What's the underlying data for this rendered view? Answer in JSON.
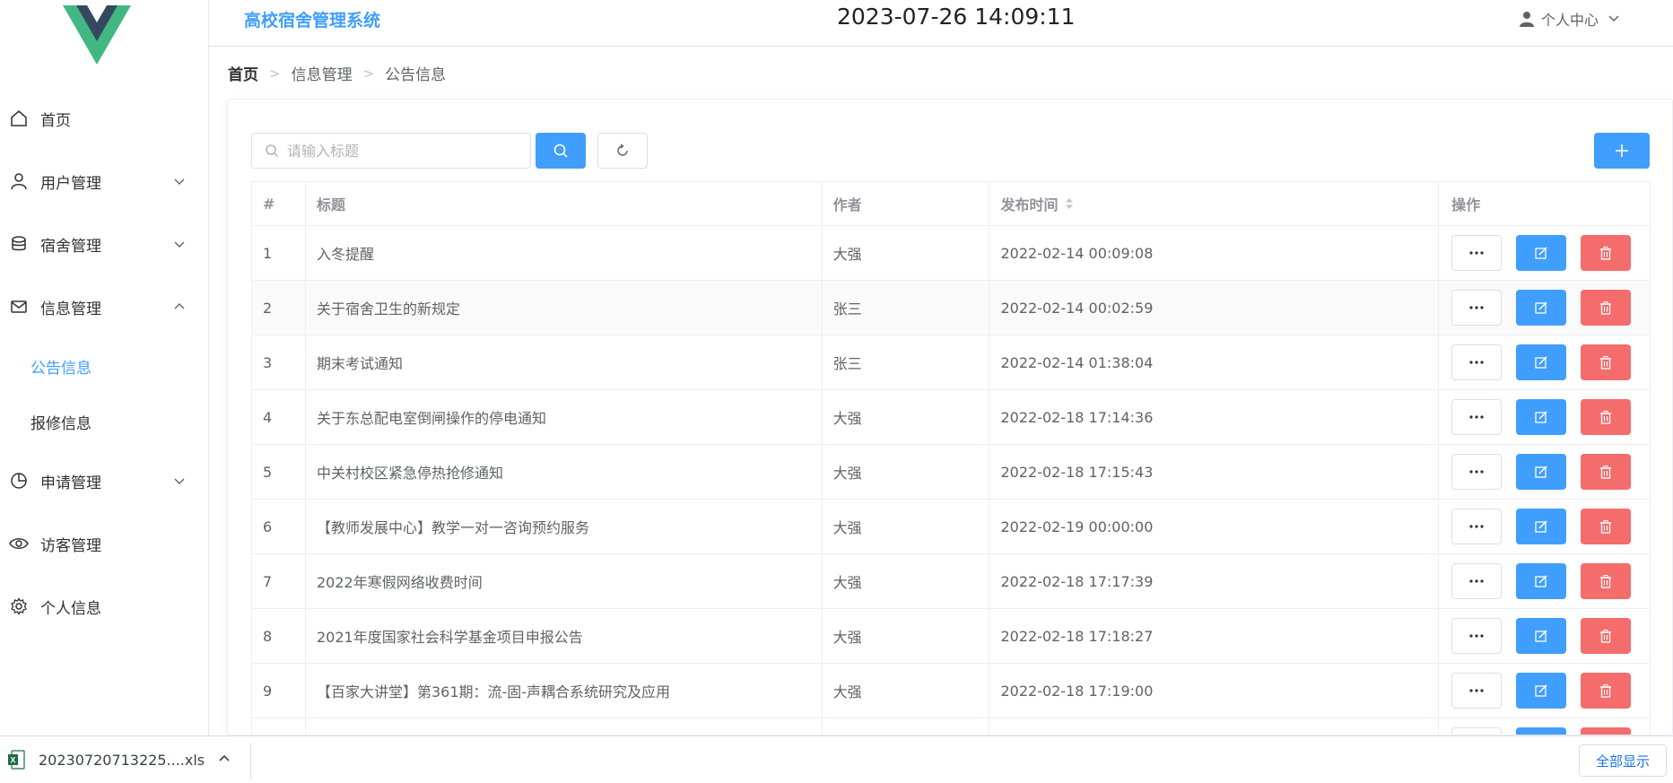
{
  "header": {
    "app_title": "高校宿舍管理系统",
    "clock": "2023-07-26 14:09:11",
    "user_center": "个人中心"
  },
  "sidebar": {
    "items": [
      {
        "label": "首页",
        "icon": "home-icon"
      },
      {
        "label": "用户管理",
        "icon": "user-icon",
        "arrow": "down"
      },
      {
        "label": "宿舍管理",
        "icon": "database-icon",
        "arrow": "down"
      },
      {
        "label": "信息管理",
        "icon": "mail-icon",
        "arrow": "up",
        "expanded": true
      },
      {
        "label": "申请管理",
        "icon": "pie-chart-icon",
        "arrow": "down"
      },
      {
        "label": "访客管理",
        "icon": "eye-icon"
      },
      {
        "label": "个人信息",
        "icon": "gear-icon"
      }
    ],
    "submenu": [
      {
        "label": "公告信息",
        "active": true
      },
      {
        "label": "报修信息",
        "active": false
      }
    ],
    "active_color": "#409eff"
  },
  "breadcrumb": [
    "首页",
    "信息管理",
    "公告信息"
  ],
  "search": {
    "placeholder": "请输入标题",
    "value": ""
  },
  "table": {
    "columns": [
      "#",
      "标题",
      "作者",
      "发布时间",
      "操作"
    ],
    "rows": [
      {
        "id": "1",
        "title": "入冬提醒",
        "author": "大强",
        "time": "2022-02-14 00:09:08"
      },
      {
        "id": "2",
        "title": "关于宿舍卫生的新规定",
        "author": "张三",
        "time": "2022-02-14 00:02:59"
      },
      {
        "id": "3",
        "title": "期末考试通知",
        "author": "张三",
        "time": "2022-02-14 01:38:04"
      },
      {
        "id": "4",
        "title": "关于东总配电室倒闸操作的停电通知",
        "author": "大强",
        "time": "2022-02-18 17:14:36"
      },
      {
        "id": "5",
        "title": "中关村校区紧急停热抢修通知",
        "author": "大强",
        "time": "2022-02-18 17:15:43"
      },
      {
        "id": "6",
        "title": "【教师发展中心】教学一对一咨询预约服务",
        "author": "大强",
        "time": "2022-02-19 00:00:00"
      },
      {
        "id": "7",
        "title": "2022年寒假网络收费时间",
        "author": "大强",
        "time": "2022-02-18 17:17:39"
      },
      {
        "id": "8",
        "title": "2021年度国家社会科学基金项目申报公告",
        "author": "大强",
        "time": "2022-02-18 17:18:27"
      },
      {
        "id": "9",
        "title": "【百家大讲堂】第361期：流-固-声耦合系统研究及应用",
        "author": "大强",
        "time": "2022-02-18 17:19:00"
      },
      {
        "id": "",
        "title": "",
        "author": "",
        "time": ""
      }
    ]
  },
  "colors": {
    "primary": "#409eff",
    "danger": "#f56c6c"
  },
  "download_bar": {
    "file_name": "20230720713225....xls",
    "show_all": "全部显示"
  }
}
